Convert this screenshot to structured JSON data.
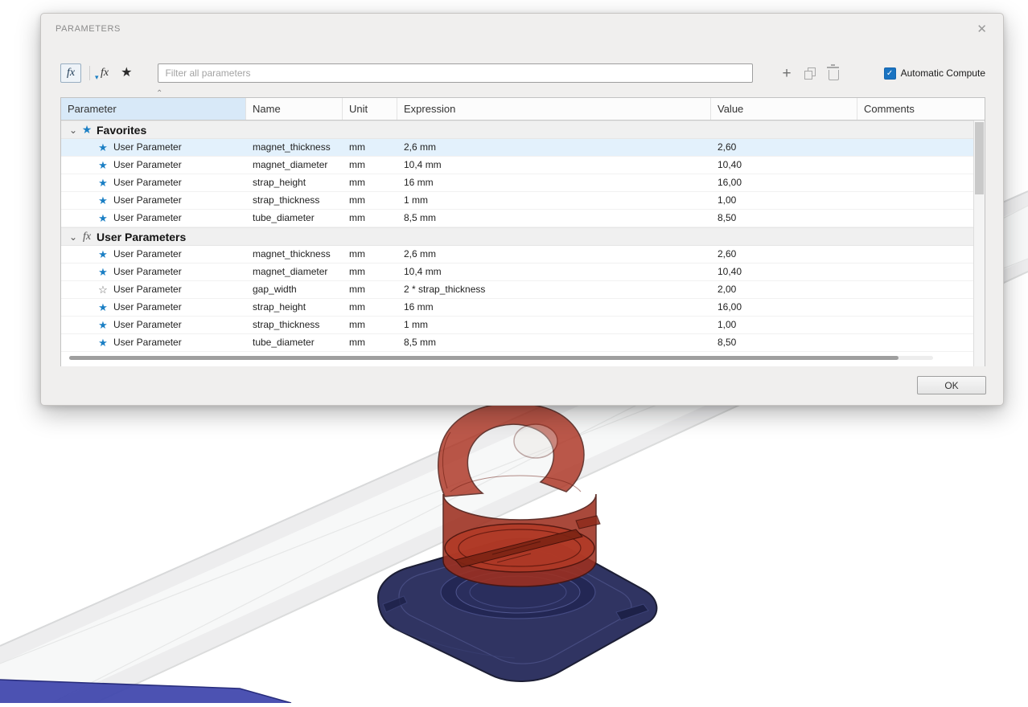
{
  "dialog": {
    "title": "PARAMETERS",
    "toolbar": {
      "filter_placeholder": "Filter all parameters",
      "automatic_compute_label": "Automatic Compute",
      "automatic_compute_checked": true
    },
    "table": {
      "columns": [
        "Parameter",
        "Name",
        "Unit",
        "Expression",
        "Value",
        "Comments"
      ],
      "groups": [
        {
          "label": "Favorites",
          "icon": "star",
          "rows": [
            {
              "parameter": "User Parameter",
              "favorite": true,
              "selected": true,
              "name": "magnet_thickness",
              "unit": "mm",
              "expression": "2,6 mm",
              "value": "2,60",
              "comments": ""
            },
            {
              "parameter": "User Parameter",
              "favorite": true,
              "name": "magnet_diameter",
              "unit": "mm",
              "expression": "10,4 mm",
              "value": "10,40",
              "comments": ""
            },
            {
              "parameter": "User Parameter",
              "favorite": true,
              "name": "strap_height",
              "unit": "mm",
              "expression": "16 mm",
              "value": "16,00",
              "comments": ""
            },
            {
              "parameter": "User Parameter",
              "favorite": true,
              "name": "strap_thickness",
              "unit": "mm",
              "expression": "1 mm",
              "value": "1,00",
              "comments": ""
            },
            {
              "parameter": "User Parameter",
              "favorite": true,
              "name": "tube_diameter",
              "unit": "mm",
              "expression": "8,5 mm",
              "value": "8,50",
              "comments": ""
            }
          ]
        },
        {
          "label": "User Parameters",
          "icon": "fx",
          "rows": [
            {
              "parameter": "User Parameter",
              "favorite": true,
              "name": "magnet_thickness",
              "unit": "mm",
              "expression": "2,6 mm",
              "value": "2,60",
              "comments": ""
            },
            {
              "parameter": "User Parameter",
              "favorite": true,
              "name": "magnet_diameter",
              "unit": "mm",
              "expression": "10,4 mm",
              "value": "10,40",
              "comments": ""
            },
            {
              "parameter": "User Parameter",
              "favorite": false,
              "name": "gap_width",
              "unit": "mm",
              "expression": "2 * strap_thickness",
              "value": "2,00",
              "comments": ""
            },
            {
              "parameter": "User Parameter",
              "favorite": true,
              "name": "strap_height",
              "unit": "mm",
              "expression": "16 mm",
              "value": "16,00",
              "comments": ""
            },
            {
              "parameter": "User Parameter",
              "favorite": true,
              "name": "strap_thickness",
              "unit": "mm",
              "expression": "1 mm",
              "value": "1,00",
              "comments": ""
            },
            {
              "parameter": "User Parameter",
              "favorite": true,
              "name": "tube_diameter",
              "unit": "mm",
              "expression": "8,5 mm",
              "value": "8,50",
              "comments": ""
            }
          ]
        }
      ]
    },
    "ok_label": "OK"
  },
  "icons": {
    "close": "✕",
    "fx": "fx",
    "caret_down_small": "▾",
    "star_filled": "★",
    "star_outline": "☆",
    "chevron_down": "⌄",
    "plus": "+",
    "sort_caret": "⌃",
    "check": "✓"
  },
  "colors": {
    "star_blue": "#1b7fc4",
    "checkbox_blue": "#1a73c1",
    "selected_row": "#e3f1fc",
    "parameter_header_highlight": "#d8e9f8",
    "model_red": "#b23a26",
    "model_blue": "#2a2e5d",
    "strap_gray": "#ededee",
    "strap_end_blue": "#3d43ab"
  }
}
